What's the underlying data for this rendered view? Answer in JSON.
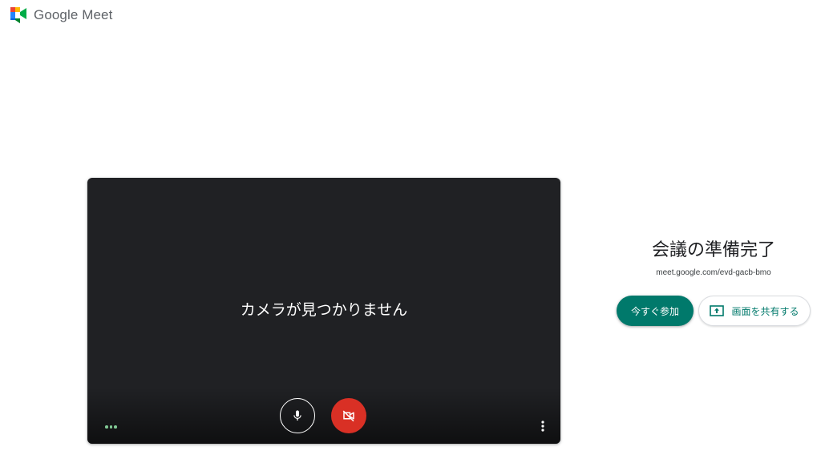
{
  "app": {
    "brand_name": "Google Meet",
    "logo_icon": "google-meet-logo"
  },
  "preview": {
    "status_text": "カメラが見つかりません",
    "mic_icon": "microphone-icon",
    "camera_icon": "camera-off-icon",
    "camera_button_color": "#d93025",
    "options_icon": "more-vert-icon",
    "audio_indicator_icon": "audio-level-dots-icon"
  },
  "join_panel": {
    "title": "会議の準備完了",
    "meeting_url": "meet.google.com/evd-gacb-bmo",
    "join_label": "今すぐ参加",
    "share_label": "画面を共有する",
    "share_icon": "present-to-all-icon",
    "accent_color": "#00796b"
  }
}
